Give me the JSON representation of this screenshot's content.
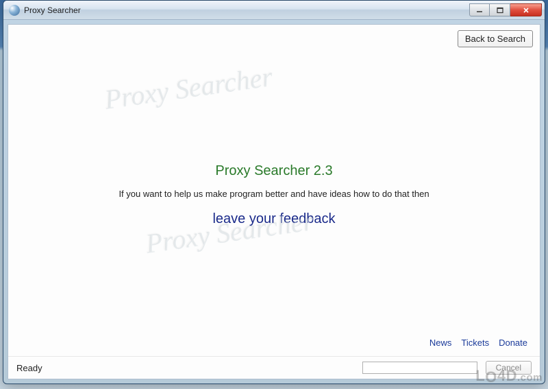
{
  "window": {
    "title": "Proxy Searcher"
  },
  "toolbar": {
    "back_to_search": "Back to Search"
  },
  "content": {
    "watermark_text": "Proxy Searcher",
    "app_title": "Proxy Searcher 2.3",
    "help_text": "If you want to help us make program better and have ideas how to do that then",
    "feedback_link": "leave your feedback"
  },
  "links": {
    "news": "News",
    "tickets": "Tickets",
    "donate": "Donate"
  },
  "status": {
    "text": "Ready",
    "cancel": "Cancel"
  },
  "site_watermark": "LO4D.com"
}
